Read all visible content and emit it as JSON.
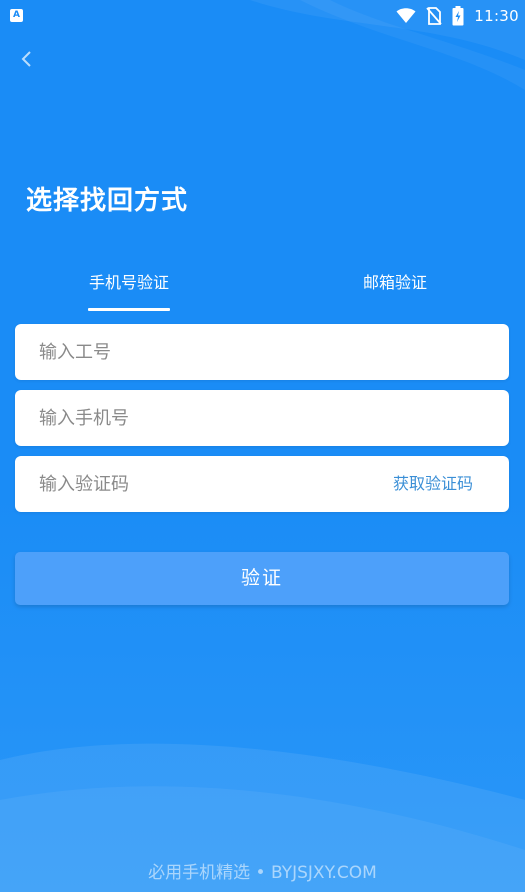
{
  "status_bar": {
    "app_icon_letter": "A",
    "time": "11:30",
    "icons": [
      "wifi-icon",
      "no-sim-icon",
      "battery-charging-icon"
    ]
  },
  "header": {
    "back_icon": "chevron-left-icon"
  },
  "page": {
    "title": "选择找回方式"
  },
  "tabs": [
    {
      "label": "手机号验证",
      "active": true
    },
    {
      "label": "邮箱验证",
      "active": false
    }
  ],
  "form": {
    "employee_id": {
      "value": "",
      "placeholder": "输入工号"
    },
    "phone": {
      "value": "",
      "placeholder": "输入手机号"
    },
    "code": {
      "value": "",
      "placeholder": "输入验证码"
    },
    "get_code_label": "获取验证码"
  },
  "actions": {
    "verify_label": "验证"
  },
  "watermark": {
    "text": "必用手机精选 • BYJSJXY.COM"
  },
  "colors": {
    "background": "#1a8cf6",
    "button": "#4da0fa",
    "link": "#3b8fd6",
    "placeholder": "#8a8a8a"
  }
}
